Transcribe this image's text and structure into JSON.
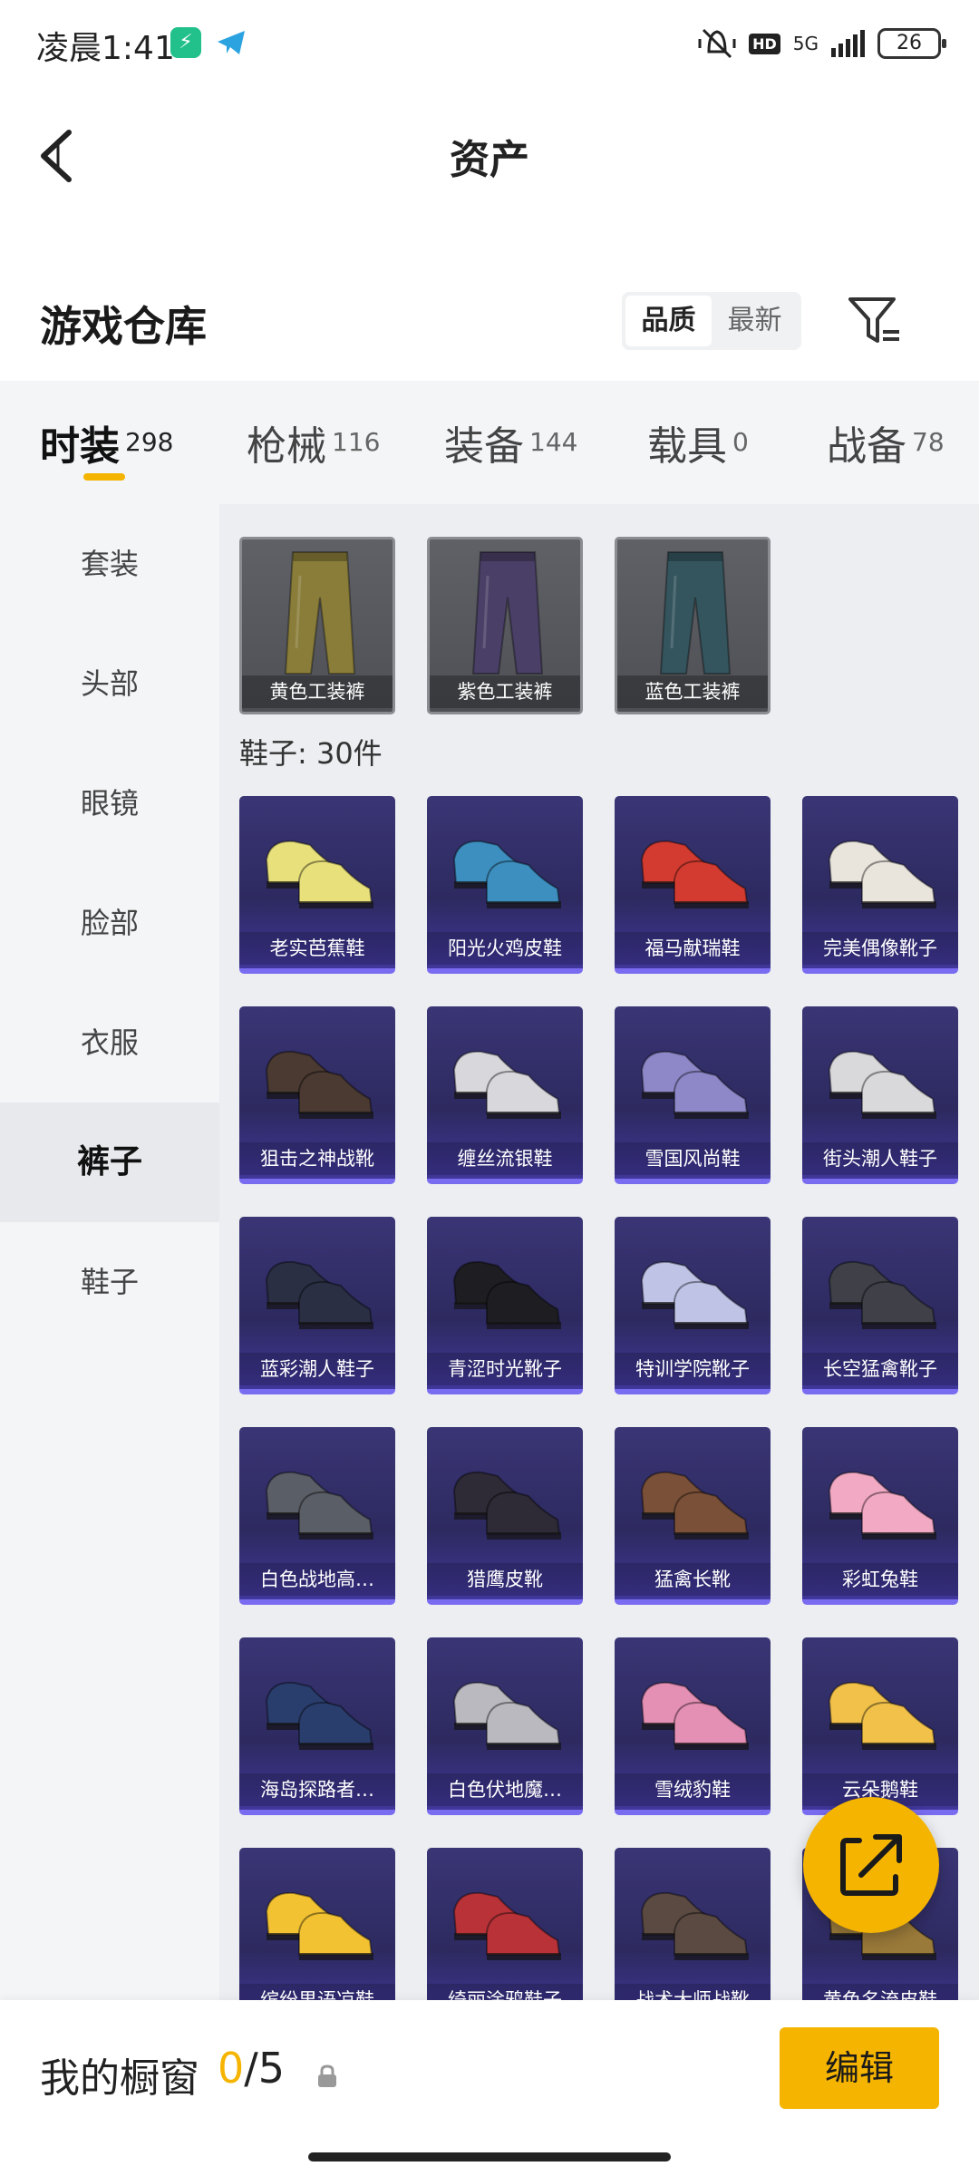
{
  "status_bar": {
    "time": "凌晨1:41",
    "network": "5G",
    "hd": "HD",
    "battery": "26"
  },
  "header": {
    "title": "资产"
  },
  "warehouse": {
    "title": "游戏仓库",
    "sort_options": [
      "品质",
      "最新"
    ],
    "sort_active": 0
  },
  "tabs": [
    {
      "name": "时装",
      "count": "298"
    },
    {
      "name": "枪械",
      "count": "116"
    },
    {
      "name": "装备",
      "count": "144"
    },
    {
      "name": "载具",
      "count": "0"
    },
    {
      "name": "战备",
      "count": "78"
    }
  ],
  "sidebar": {
    "items": [
      "套装",
      "头部",
      "眼镜",
      "脸部",
      "衣服",
      "裤子",
      "鞋子"
    ],
    "active_index": 5
  },
  "pants": [
    {
      "name": "黄色工装裤",
      "color": "#8a7d3a"
    },
    {
      "name": "紫色工装裤",
      "color": "#4a3f66"
    },
    {
      "name": "蓝色工装裤",
      "color": "#35555e"
    }
  ],
  "shoes_section_title": "鞋子: 30件",
  "shoes": [
    {
      "name": "老实芭蕉鞋",
      "color": "#e8e07a"
    },
    {
      "name": "阳光火鸡皮鞋",
      "color": "#3d8fc0"
    },
    {
      "name": "福马献瑞鞋",
      "color": "#d43b30"
    },
    {
      "name": "完美偶像靴子",
      "color": "#e9e4dc"
    },
    {
      "name": "狙击之神战靴",
      "color": "#4a3a32"
    },
    {
      "name": "缠丝流银鞋",
      "color": "#d8d8dc"
    },
    {
      "name": "雪国风尚鞋",
      "color": "#8e87c8"
    },
    {
      "name": "街头潮人鞋子",
      "color": "#d9d9dc"
    },
    {
      "name": "蓝彩潮人鞋子",
      "color": "#2a2f44"
    },
    {
      "name": "青涩时光靴子",
      "color": "#1e1e22"
    },
    {
      "name": "特训学院靴子",
      "color": "#bfc3e6"
    },
    {
      "name": "长空猛禽靴子",
      "color": "#3f4048"
    },
    {
      "name": "白色战地高…",
      "color": "#5a5e66"
    },
    {
      "name": "猎鹰皮靴",
      "color": "#2e2a36"
    },
    {
      "name": "猛禽长靴",
      "color": "#7a5038"
    },
    {
      "name": "彩虹兔鞋",
      "color": "#f2a9c4"
    },
    {
      "name": "海岛探路者…",
      "color": "#2a3e6e"
    },
    {
      "name": "白色伏地魔…",
      "color": "#b9b9bf"
    },
    {
      "name": "雪绒豹鞋",
      "color": "#e48fb4"
    },
    {
      "name": "云朵鹅鞋",
      "color": "#f1c14a"
    },
    {
      "name": "缤纷果语凉鞋",
      "color": "#f2c232"
    },
    {
      "name": "绮丽涂鸦鞋子",
      "color": "#b83238"
    },
    {
      "name": "战术大师战靴",
      "color": "#5a4a42"
    },
    {
      "name": "黄色名流皮鞋",
      "color": "#9a7a3a"
    }
  ],
  "bottom_bar": {
    "showcase_label": "我的橱窗",
    "showcase_current": "0",
    "showcase_total": "/5",
    "edit_label": "编辑"
  }
}
